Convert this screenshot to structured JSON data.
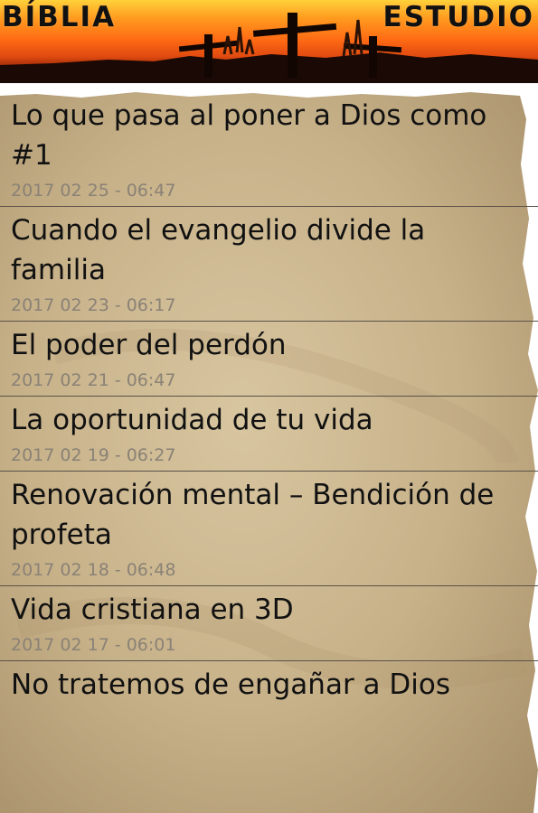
{
  "header": {
    "title_left": "BÍBLIA",
    "title_right": "ESTUDIO"
  },
  "items": [
    {
      "title": "Lo que pasa al poner a Dios como #1",
      "date": "2017 02 25 - 06:47"
    },
    {
      "title": "Cuando el evangelio divide la familia",
      "date": "2017 02 23 - 06:17"
    },
    {
      "title": "El poder del perdón",
      "date": "2017 02 21 - 06:47"
    },
    {
      "title": "La oportunidad de tu vida",
      "date": "2017 02 19 - 06:27"
    },
    {
      "title": "Renovación mental – Bendición de profeta",
      "date": "2017 02 18 - 06:48"
    },
    {
      "title": "Vida cristiana en 3D",
      "date": "2017 02 17 - 06:01"
    },
    {
      "title": "No tratemos de engañar a Dios",
      "date": ""
    }
  ],
  "colors": {
    "parchment": "#c9b48e",
    "divider": "#5a5247",
    "title_text": "#111111",
    "date_text": "#8a8276"
  },
  "icons": [
    "crosses-silhouette"
  ]
}
